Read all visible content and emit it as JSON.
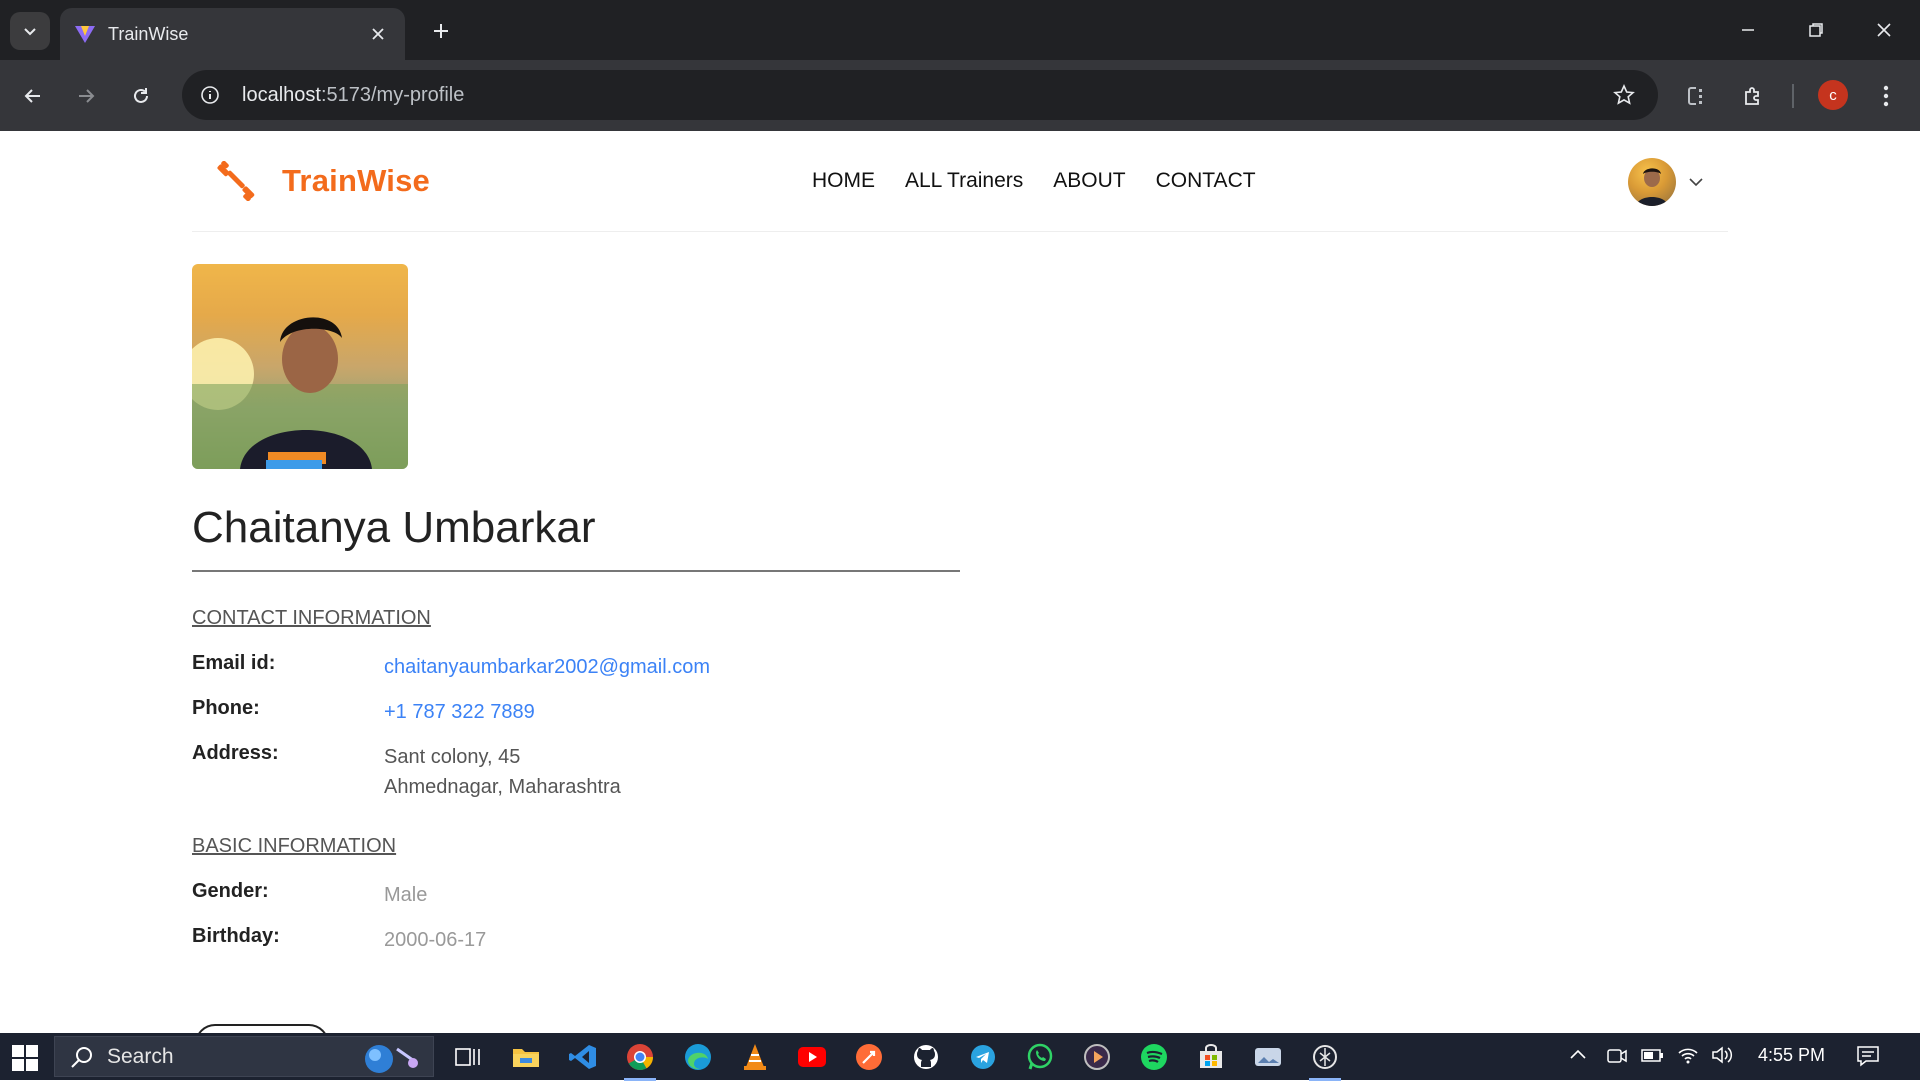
{
  "browser": {
    "tab_title": "TrainWise",
    "url_host": "localhost",
    "url_path": ":5173/my-profile",
    "profile_initial": "c"
  },
  "site": {
    "brand": "TrainWise",
    "nav": [
      "HOME",
      "ALL Trainers",
      "ABOUT",
      "CONTACT"
    ],
    "brand_color": "#f36b1c"
  },
  "profile": {
    "name": "Chaitanya Umbarkar",
    "contact_title": "CONTACT INFORMATION",
    "email_label": "Email id:",
    "email": "chaitanyaumbarkar2002@gmail.com",
    "phone_label": "Phone:",
    "phone": "+1 787 322 7889",
    "address_label": "Address:",
    "address_line1": "Sant colony, 45",
    "address_line2": "Ahmednagar, Maharashtra",
    "basic_title": "BASIC INFORMATION",
    "gender_label": "Gender:",
    "gender": "Male",
    "birthday_label": "Birthday:",
    "birthday": "2000-06-17"
  },
  "taskbar": {
    "search_label": "Search",
    "time": "4:55 PM",
    "apps": [
      "task-view-icon",
      "file-explorer-icon",
      "vscode-icon",
      "chrome-icon",
      "edge-icon",
      "vlc-icon",
      "youtube-icon",
      "postman-icon",
      "github-icon",
      "telegram-icon",
      "whatsapp-icon",
      "media-player-icon",
      "spotify-icon",
      "store-icon",
      "photos-icon",
      "chatgpt-icon"
    ]
  }
}
